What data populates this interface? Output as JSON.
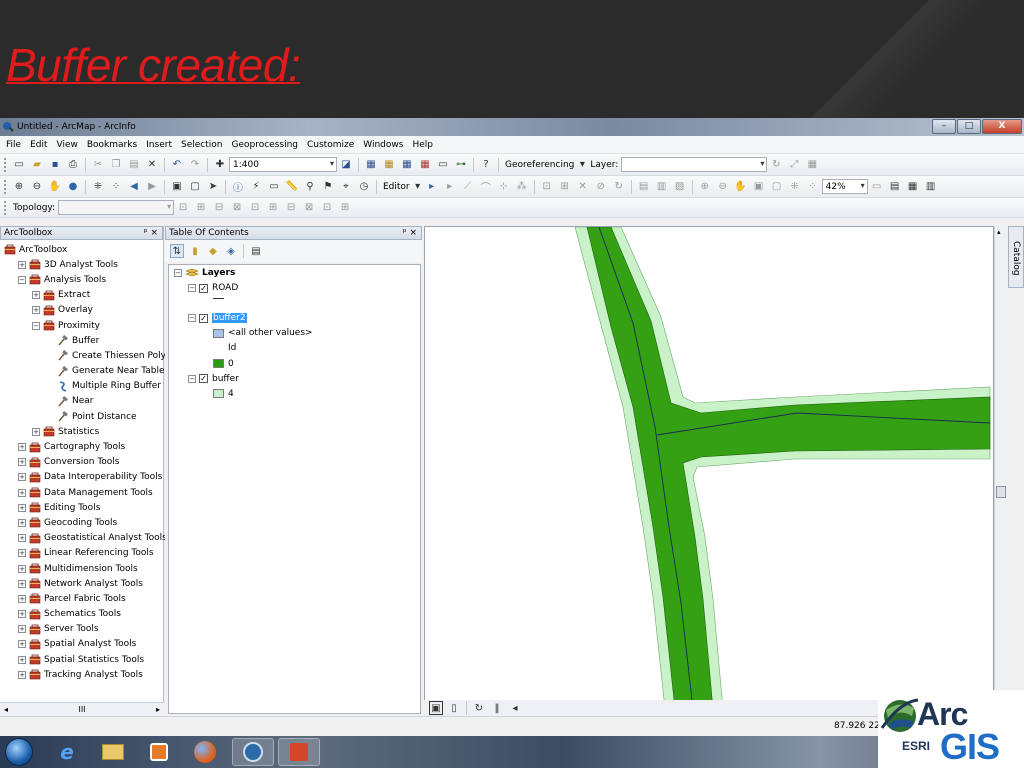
{
  "slide": {
    "title": "Buffer created:"
  },
  "window": {
    "title": "Untitled - ArcMap - ArcInfo",
    "buttons": [
      "–",
      "□",
      "X"
    ]
  },
  "menu": [
    "File",
    "Edit",
    "View",
    "Bookmarks",
    "Insert",
    "Selection",
    "Geoprocessing",
    "Customize",
    "Windows",
    "Help"
  ],
  "toolbar": {
    "scale": "1:400",
    "georeferencing_label": "Georeferencing",
    "layer_label": "Layer:",
    "layer_value": "",
    "editor_label": "Editor",
    "zoom_value": "42%",
    "topology_label": "Topology:",
    "topology_value": ""
  },
  "arctoolbox": {
    "title": "ArcToolbox",
    "pin": "ᵖ ×",
    "items": [
      {
        "label": "ArcToolbox",
        "indent": 0,
        "kind": "toolbox",
        "exp": ""
      },
      {
        "label": "3D Analyst Tools",
        "indent": 1,
        "kind": "toolbox",
        "exp": "+"
      },
      {
        "label": "Analysis Tools",
        "indent": 1,
        "kind": "toolbox",
        "exp": "−"
      },
      {
        "label": "Extract",
        "indent": 2,
        "kind": "toolset",
        "exp": "+"
      },
      {
        "label": "Overlay",
        "indent": 2,
        "kind": "toolset",
        "exp": "+"
      },
      {
        "label": "Proximity",
        "indent": 2,
        "kind": "toolset",
        "exp": "−"
      },
      {
        "label": "Buffer",
        "indent": 3,
        "kind": "tool",
        "exp": ""
      },
      {
        "label": "Create Thiessen Polygons",
        "indent": 3,
        "kind": "tool",
        "exp": ""
      },
      {
        "label": "Generate Near Table",
        "indent": 3,
        "kind": "tool",
        "exp": ""
      },
      {
        "label": "Multiple Ring Buffer",
        "indent": 3,
        "kind": "script",
        "exp": ""
      },
      {
        "label": "Near",
        "indent": 3,
        "kind": "tool",
        "exp": ""
      },
      {
        "label": "Point Distance",
        "indent": 3,
        "kind": "tool",
        "exp": ""
      },
      {
        "label": "Statistics",
        "indent": 2,
        "kind": "toolset",
        "exp": "+"
      },
      {
        "label": "Cartography Tools",
        "indent": 1,
        "kind": "toolbox",
        "exp": "+"
      },
      {
        "label": "Conversion Tools",
        "indent": 1,
        "kind": "toolbox",
        "exp": "+"
      },
      {
        "label": "Data Interoperability Tools",
        "indent": 1,
        "kind": "toolbox",
        "exp": "+"
      },
      {
        "label": "Data Management Tools",
        "indent": 1,
        "kind": "toolbox",
        "exp": "+"
      },
      {
        "label": "Editing Tools",
        "indent": 1,
        "kind": "toolbox",
        "exp": "+"
      },
      {
        "label": "Geocoding Tools",
        "indent": 1,
        "kind": "toolbox",
        "exp": "+"
      },
      {
        "label": "Geostatistical Analyst Tools",
        "indent": 1,
        "kind": "toolbox",
        "exp": "+"
      },
      {
        "label": "Linear Referencing Tools",
        "indent": 1,
        "kind": "toolbox",
        "exp": "+"
      },
      {
        "label": "Multidimension Tools",
        "indent": 1,
        "kind": "toolbox",
        "exp": "+"
      },
      {
        "label": "Network Analyst Tools",
        "indent": 1,
        "kind": "toolbox",
        "exp": "+"
      },
      {
        "label": "Parcel Fabric Tools",
        "indent": 1,
        "kind": "toolbox",
        "exp": "+"
      },
      {
        "label": "Schematics Tools",
        "indent": 1,
        "kind": "toolbox",
        "exp": "+"
      },
      {
        "label": "Server Tools",
        "indent": 1,
        "kind": "toolbox",
        "exp": "+"
      },
      {
        "label": "Spatial Analyst Tools",
        "indent": 1,
        "kind": "toolbox",
        "exp": "+"
      },
      {
        "label": "Spatial Statistics Tools",
        "indent": 1,
        "kind": "toolbox",
        "exp": "+"
      },
      {
        "label": "Tracking Analyst Tools",
        "indent": 1,
        "kind": "toolbox",
        "exp": "+"
      }
    ],
    "scroll_thumb": "III"
  },
  "toc": {
    "title": "Table Of Contents",
    "pin": "ᵖ ×",
    "root": "Layers",
    "layers": [
      {
        "name": "ROAD",
        "legend": [
          {
            "label": "",
            "swatch": "line"
          }
        ]
      },
      {
        "name": "buffer2",
        "selected": true,
        "legend": [
          {
            "label": "<all other values>",
            "swatch": "#a9c4ea"
          },
          {
            "label": "Id",
            "swatch": "none"
          },
          {
            "label": "0",
            "swatch": "#2e9c12"
          }
        ]
      },
      {
        "name": "buffer",
        "legend": [
          {
            "label": "4",
            "swatch": "#c9f2c9"
          }
        ]
      }
    ]
  },
  "map": {
    "buffer_outer_color": "#c9f2c9",
    "buffer_inner_color": "#34a014",
    "road_color": "#1a2a55"
  },
  "catalog_tab": "Catalog",
  "status": {
    "coords": "87.926  22.2"
  },
  "logo": {
    "arc": "Arc",
    "esri": "ESRI",
    "gis": "GIS"
  }
}
